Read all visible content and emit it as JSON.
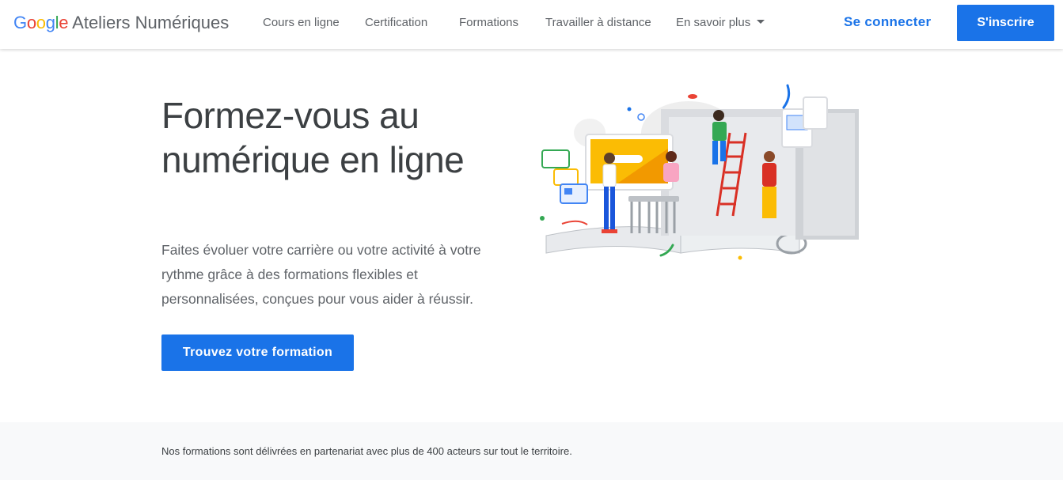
{
  "header": {
    "logo_letters": [
      {
        "char": "G",
        "color": "#4285F4"
      },
      {
        "char": "o",
        "color": "#EA4335"
      },
      {
        "char": "o",
        "color": "#FBBC05"
      },
      {
        "char": "g",
        "color": "#4285F4"
      },
      {
        "char": "l",
        "color": "#34A853"
      },
      {
        "char": "e",
        "color": "#EA4335"
      }
    ],
    "brand_name": "Ateliers Numériques",
    "nav": [
      {
        "label": "Cours en ligne"
      },
      {
        "label": "Certification"
      },
      {
        "label": "Formations"
      },
      {
        "label": "Travailler à distance"
      },
      {
        "label": "En savoir plus",
        "icon": "caret-down-icon"
      }
    ],
    "login_label": "Se connecter",
    "signup_label": "S'inscrire"
  },
  "hero": {
    "title": "Formez-vous au numérique en ligne",
    "description": "Faites évoluer votre carrière ou votre activité à votre rythme grâce à des formations flexibles et personnalisées, conçues pour vous aider à réussir.",
    "cta_label": "Trouvez votre formation"
  },
  "partners": {
    "text": "Nos formations sont délivrées en partenariat avec plus de 400 acteurs sur tout le territoire."
  },
  "colors": {
    "accent": "#1a73e8",
    "text_dark": "#3c4043",
    "text_muted": "#5f6368",
    "band_bg": "#f8f9fa"
  }
}
